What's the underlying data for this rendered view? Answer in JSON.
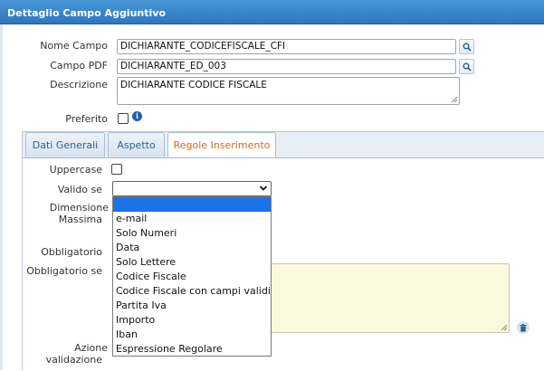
{
  "window": {
    "title": "Dettaglio Campo Aggiuntivo"
  },
  "form": {
    "nome_campo": {
      "label": "Nome Campo",
      "value": "DICHIARANTE_CODICEFISCALE_CFI"
    },
    "campo_pdf": {
      "label": "Campo PDF",
      "value": "DICHIARANTE_ED_003"
    },
    "descrizione": {
      "label": "Descrizione",
      "value": "DICHIARANTE CODICE FISCALE"
    },
    "preferito": {
      "label": "Preferito"
    }
  },
  "tabs": [
    {
      "label": "Dati Generali"
    },
    {
      "label": "Aspetto"
    },
    {
      "label": "Regole Inserimento"
    }
  ],
  "rules": {
    "uppercase_label": "Uppercase",
    "valido_se_label": "Valido se",
    "dimensione_label_1": "Dimensione",
    "dimensione_label_2": "Massima",
    "obbligatorio_label": "Obbligatorio",
    "obbligatorio_se_label": "Obbligatorio se",
    "azione_label_1": "Azione",
    "azione_label_2": "validazione"
  },
  "dropdown": {
    "options": [
      "",
      "e-mail",
      "Solo Numeri",
      "Data",
      "Solo Lettere",
      "Codice Fiscale",
      "Codice Fiscale con campi validi",
      "Partita Iva",
      "Importo",
      "Iban",
      "Espressione Regolare"
    ]
  },
  "icons": {
    "lookup": "search-icon",
    "info": "info-icon",
    "trash": "trash-icon",
    "select_arrow": "chevron-down-icon"
  },
  "colors": {
    "titlebar": "#2d77bf",
    "active_tab_text": "#d36b16",
    "selected_option": "#1a73e8",
    "textarea_bg": "#fbf9dd"
  }
}
